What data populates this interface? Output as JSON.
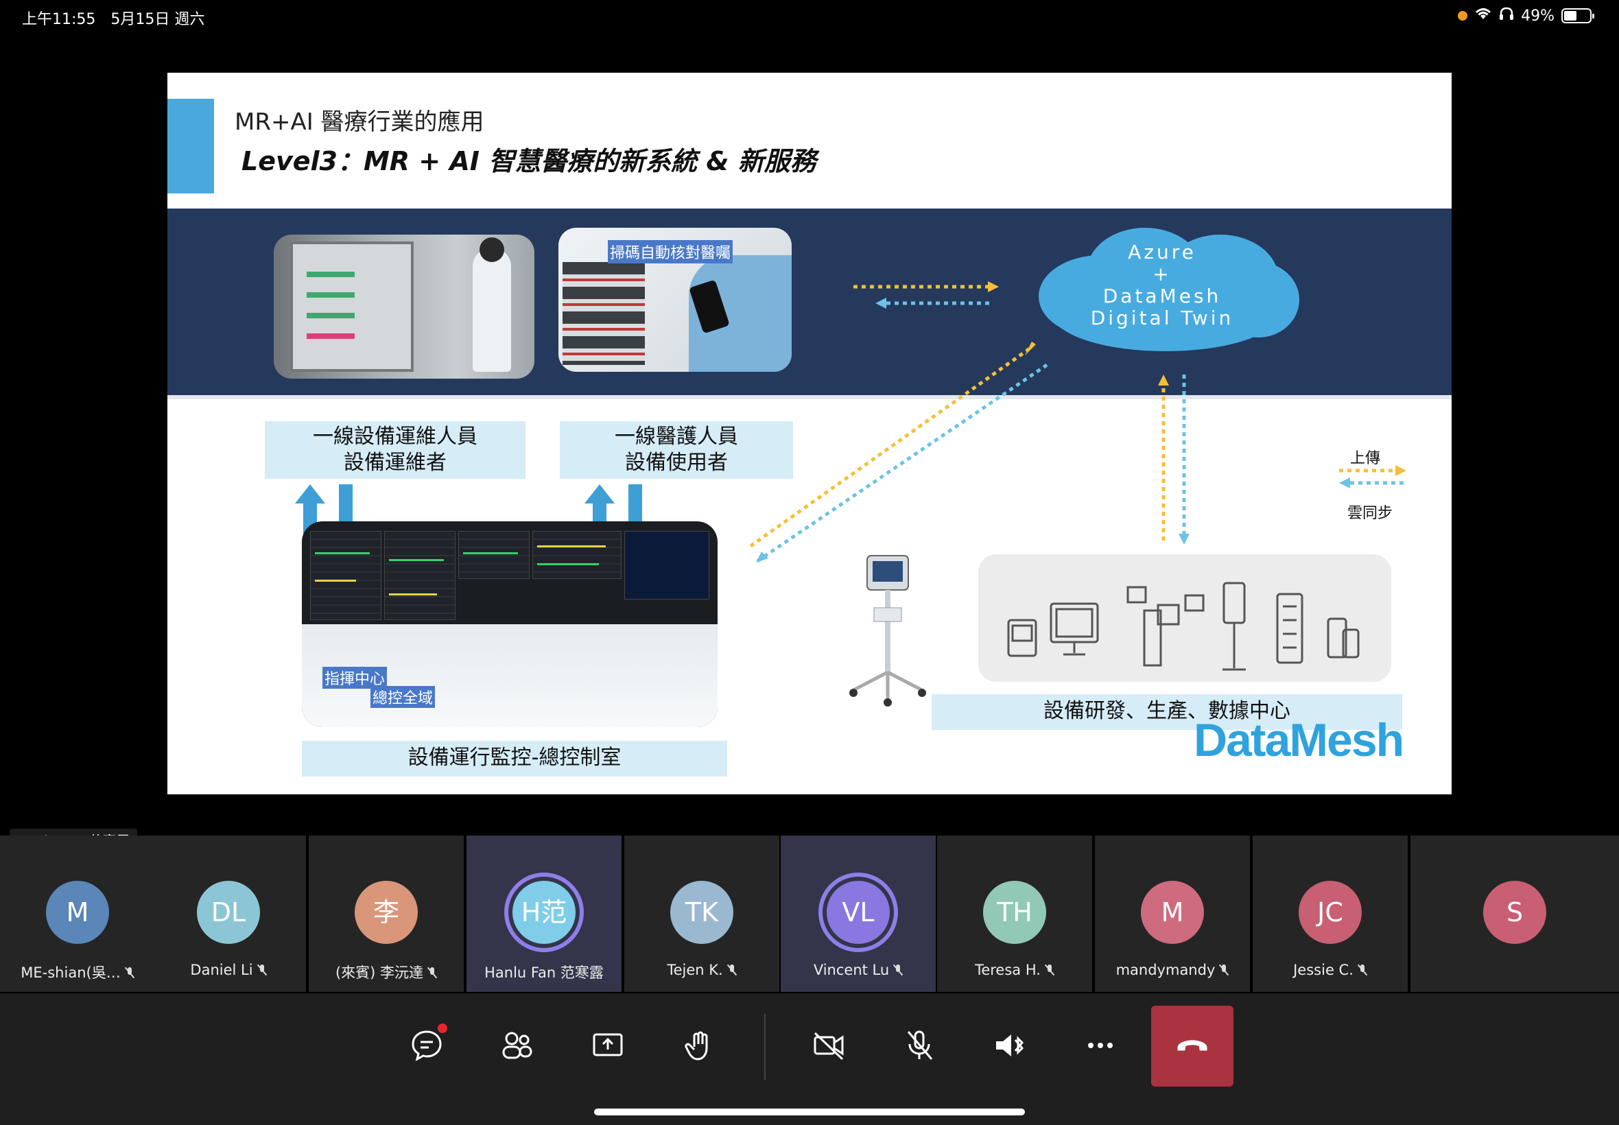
{
  "status_bar": {
    "time": "上午11:55",
    "date": "5月15日 週六",
    "battery": "49%"
  },
  "slide": {
    "title_line1": "MR+AI 醫療行業的應用",
    "title_line2": "Level3：MR + AI 智慧醫療的新系統 & 新服務",
    "photo2_caption": "掃碼自動核對醫囑",
    "role1_line1": "一線設備運維人員",
    "role1_line2": "設備運維者",
    "role2_line1": "一線醫護人員",
    "role2_line2": "設備使用者",
    "cloud_line1": "Azure",
    "cloud_line2": "+",
    "cloud_line3": "DataMesh",
    "cloud_line4": "Digital Twin",
    "legend_upload": "上傳",
    "legend_sync": "雲同步",
    "monitor_label1": "指揮中心",
    "monitor_label2": "總控全域",
    "monitor_caption": "設備運行監控-總控制室",
    "center_caption": "設備研發、生產、數據中心",
    "logo_text": "DataMesh",
    "colors": {
      "accent": "#4aa8dc",
      "band": "#24395c",
      "upload_arrow": "#f6bf3a",
      "sync_arrow": "#6cc3e6"
    }
  },
  "speaker_tag": "Hanlu Fan 范寒露",
  "participants": [
    {
      "initials": "M",
      "name": "ME-shian(吳…",
      "color": "#5a86b8",
      "active": false,
      "muted": true
    },
    {
      "initials": "DL",
      "name": "Daniel Li",
      "color": "#8cc6d6",
      "active": false,
      "muted": true
    },
    {
      "initials": "李",
      "name": "(來賓) 李沅達",
      "color": "#d9967a",
      "active": false,
      "muted": true
    },
    {
      "initials": "H范",
      "name": "Hanlu Fan 范寒露",
      "color": "#7fcde8",
      "active": true,
      "muted": false
    },
    {
      "initials": "TK",
      "name": "Tejen K.",
      "color": "#9ab8d0",
      "active": false,
      "muted": true
    },
    {
      "initials": "VL",
      "name": "Vincent Lu",
      "color": "#8a78e0",
      "active": true,
      "muted": true
    },
    {
      "initials": "TH",
      "name": "Teresa H.",
      "color": "#92c8b6",
      "active": false,
      "muted": true
    },
    {
      "initials": "M",
      "name": "mandymandy",
      "color": "#cf6b7e",
      "active": false,
      "muted": true
    },
    {
      "initials": "JC",
      "name": "Jessie C.",
      "color": "#c85f73",
      "active": false,
      "muted": true
    },
    {
      "initials": "S",
      "name": "",
      "color": "#c85f73",
      "active": false,
      "muted": false
    }
  ],
  "controls": {
    "icons": [
      "chat-icon",
      "participants-icon",
      "share-screen-icon",
      "raise-hand-icon",
      "video-off-icon",
      "mic-off-icon",
      "speaker-icon",
      "more-icon",
      "hang-up-icon"
    ]
  }
}
